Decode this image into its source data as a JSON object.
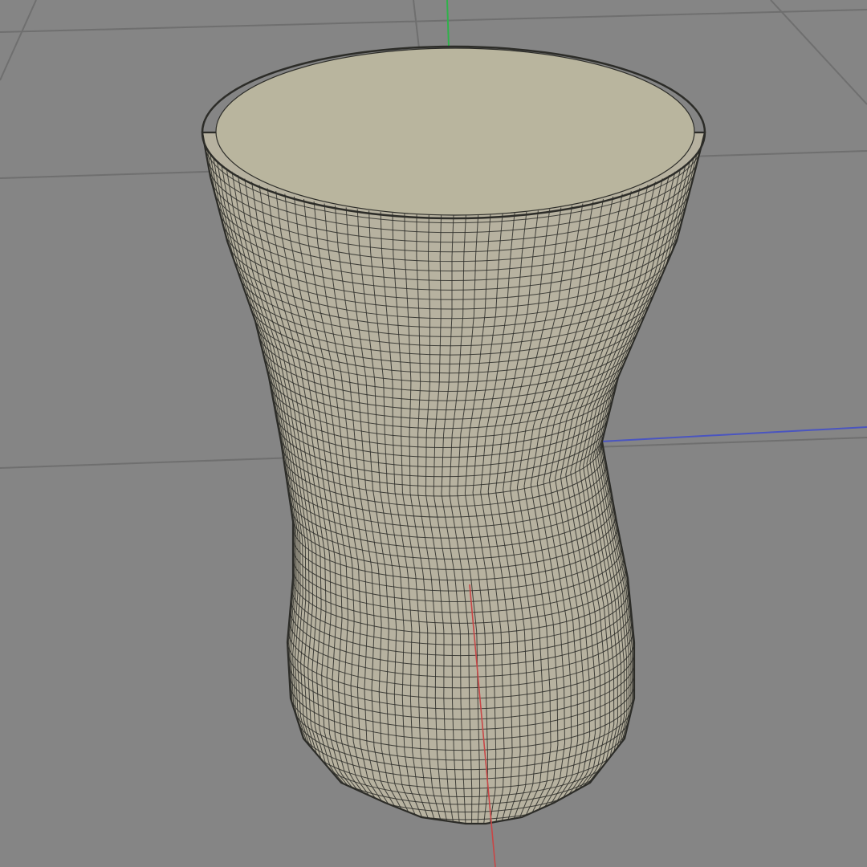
{
  "viewport": {
    "background_color": "#858585",
    "grid_color": "#6f6f6f",
    "grid_visible": true
  },
  "axes": {
    "x_axis_color": "#c84646",
    "y_axis_color": "#2fb24a",
    "z_axis_color": "#4a55c0"
  },
  "mesh": {
    "shape": "vase",
    "surface_color": "#b7b2a0",
    "top_cap_color": "#b9b59e",
    "wireframe_color": "#2c2c28",
    "wireframe_visible": true
  }
}
